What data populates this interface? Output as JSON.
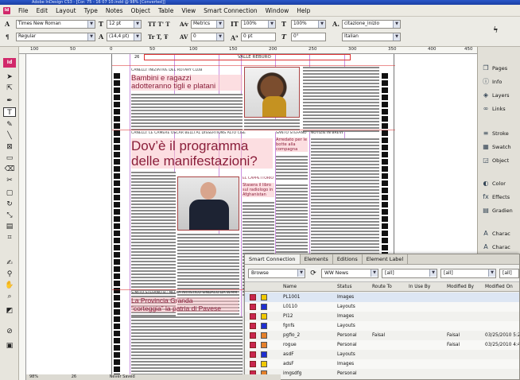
{
  "titlebar": {
    "text": "Adobe InDesign CS3 - [Cor. 75 - 16 07 10.indd @ 98% [Converted]]"
  },
  "menubar": {
    "app_badge": "Id",
    "items": [
      "File",
      "Edit",
      "Layout",
      "Type",
      "Notes",
      "Object",
      "Table",
      "View",
      "Smart Connection",
      "Window",
      "Help"
    ]
  },
  "control": {
    "font_family": "Times New Roman",
    "font_style": "Regular",
    "font_size": "12 pt",
    "leading": "(14,4 pt)",
    "kerning": "Metrics",
    "tracking": "0",
    "vscale": "100%",
    "hscale": "100%",
    "baseline": "0 pt",
    "skew": "0°",
    "char_style": "citazione_inizio",
    "language": "Italian"
  },
  "ruler": {
    "ticks": [
      "100",
      "50",
      "0",
      "50",
      "100",
      "150",
      "200",
      "250",
      "300",
      "350",
      "400",
      "450"
    ]
  },
  "page": {
    "page_number": "26",
    "section_head": "VALLE REBURO",
    "story1": {
      "kicker": "CANELLI: INIZIATIVE DEL ROTARY CLUB",
      "headline_l1": "Bambini e ragazzi",
      "headline_l2": "adotteranno tigli e platani"
    },
    "story2": {
      "kicker": "CANELLI: LE CAMERE OSCAR BELLI AL DISSERTIONS ALTO CISE",
      "headline_l1": "Dov’è il programma",
      "headline_l2": "delle manifestazioni?"
    },
    "sidebar1": {
      "kicker": "SANTO STEFANO B.",
      "text": "Arredato per le botte alla compagna"
    },
    "sidebar2": {
      "kicker": "NOTIZIE IN BREVE"
    },
    "sidebar3": {
      "kicker": "EL CAPPETTORIO",
      "text": "Stasera il libro sul radiologo in Afghanistan"
    },
    "story3": {
      "kicker": "S.MITO STEFANO B.: NELLA ARTISTICO SINDACO DA W.MM",
      "headline_l1": "La Provincia Granda",
      "headline_l2": "“corteggia” la patria di Pavese"
    }
  },
  "dock": {
    "items": [
      "Pages",
      "Info",
      "Layers",
      "Links",
      "Stroke",
      "Swatch",
      "Object",
      "Color",
      "Effects",
      "Gradien",
      "Charac",
      "Charac"
    ]
  },
  "smart_connection": {
    "tabs": [
      "Smart Connection",
      "Elements",
      "Editions",
      "Element Label"
    ],
    "filters": {
      "mode": "Browse",
      "brand": "WW News",
      "issue": "[all]",
      "section": "[all]",
      "state": "[all]"
    },
    "columns": [
      "Name",
      "Status",
      "Route To",
      "In Use By",
      "Modified By",
      "Modified On"
    ],
    "rows": [
      {
        "name": "PL1001",
        "status": "Images",
        "route": "",
        "inuse": "",
        "modby": "",
        "modon": "",
        "color": "#f0c800"
      },
      {
        "name": "L0110",
        "status": "Layouts",
        "route": "",
        "inuse": "",
        "modby": "",
        "modon": "",
        "color": "#1f2fd0"
      },
      {
        "name": "Pl12",
        "status": "Images",
        "route": "",
        "inuse": "",
        "modby": "",
        "modon": "",
        "color": "#f0c800"
      },
      {
        "name": "fgnfs",
        "status": "Layouts",
        "route": "",
        "inuse": "",
        "modby": "",
        "modon": "",
        "color": "#1f2fd0"
      },
      {
        "name": "pgfio_2",
        "status": "Personal",
        "route": "Faisal",
        "inuse": "",
        "modby": "Faisal",
        "modon": "03/25/2010 5:2",
        "color": "#e5802a"
      },
      {
        "name": "rogue",
        "status": "Personal",
        "route": "",
        "inuse": "",
        "modby": "Faisal",
        "modon": "03/25/2010 4:4",
        "color": "#e5802a"
      },
      {
        "name": "asdF",
        "status": "Layouts",
        "route": "",
        "inuse": "",
        "modby": "",
        "modon": "",
        "color": "#1f2fd0"
      },
      {
        "name": "adsF",
        "status": "Images",
        "route": "",
        "inuse": "",
        "modby": "",
        "modon": "",
        "color": "#f0c800"
      },
      {
        "name": "imgsdfg",
        "status": "Personal",
        "route": "",
        "inuse": "",
        "modby": "",
        "modon": "",
        "color": "#e5802a"
      }
    ]
  },
  "status": {
    "zoom": "98%",
    "page": "26",
    "save_state": "Never Saved"
  }
}
